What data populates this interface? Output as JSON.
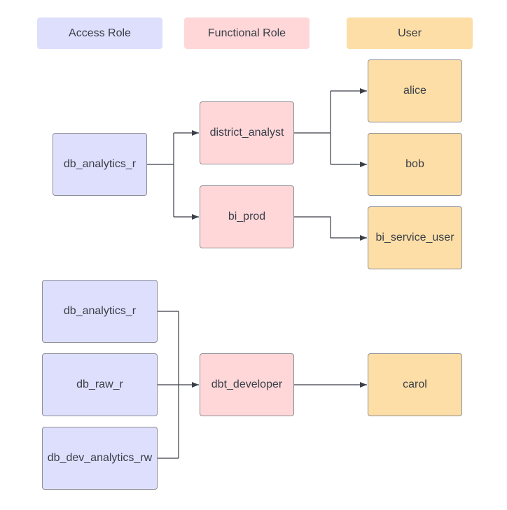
{
  "legend": {
    "access_role": "Access Role",
    "functional_role": "Functional Role",
    "user": "User"
  },
  "colors": {
    "access_role": "#dedffc",
    "functional_role": "#ffd7d8",
    "user": "#fddea6",
    "connector": "#3a3e48"
  },
  "nodes": {
    "access_db_analytics_r_1": "db_analytics_r",
    "func_district_analyst": "district_analyst",
    "func_bi_prod": "bi_prod",
    "user_alice": "alice",
    "user_bob": "bob",
    "user_bi_service_user": "bi_service_user",
    "access_db_analytics_r_2": "db_analytics_r",
    "access_db_raw_r": "db_raw_r",
    "access_db_dev_analytics_rw": "db_dev_analytics_rw",
    "func_dbt_developer": "dbt_developer",
    "user_carol": "carol"
  },
  "edges": [
    [
      "access_db_analytics_r_1",
      "func_district_analyst"
    ],
    [
      "access_db_analytics_r_1",
      "func_bi_prod"
    ],
    [
      "func_district_analyst",
      "user_alice"
    ],
    [
      "func_district_analyst",
      "user_bob"
    ],
    [
      "func_bi_prod",
      "user_bi_service_user"
    ],
    [
      "access_db_analytics_r_2",
      "func_dbt_developer"
    ],
    [
      "access_db_raw_r",
      "func_dbt_developer"
    ],
    [
      "access_db_dev_analytics_rw",
      "func_dbt_developer"
    ],
    [
      "func_dbt_developer",
      "user_carol"
    ]
  ]
}
